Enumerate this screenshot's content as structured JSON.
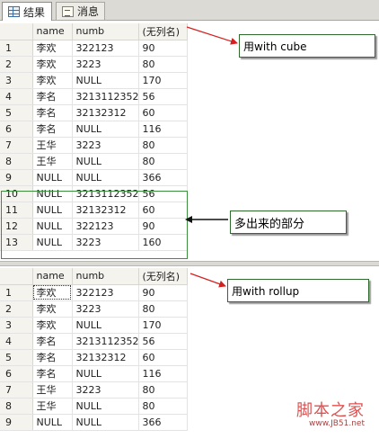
{
  "tabs": [
    {
      "label": "结果",
      "icon": "grid-results-icon",
      "active": true
    },
    {
      "label": "消息",
      "icon": "messages-icon",
      "active": false
    }
  ],
  "columns": [
    "name",
    "numb",
    "(无列名)"
  ],
  "grid_cube": {
    "rows": [
      [
        "1",
        "李欢",
        "322123",
        "90"
      ],
      [
        "2",
        "李欢",
        "3223",
        "80"
      ],
      [
        "3",
        "李欢",
        "NULL",
        "170"
      ],
      [
        "4",
        "李名",
        "3213112352",
        "56"
      ],
      [
        "5",
        "李名",
        "32132312",
        "60"
      ],
      [
        "6",
        "李名",
        "NULL",
        "116"
      ],
      [
        "7",
        "王华",
        "3223",
        "80"
      ],
      [
        "8",
        "王华",
        "NULL",
        "80"
      ],
      [
        "9",
        "NULL",
        "NULL",
        "366"
      ],
      [
        "10",
        "NULL",
        "3213112352",
        "56"
      ],
      [
        "11",
        "NULL",
        "32132312",
        "60"
      ],
      [
        "12",
        "NULL",
        "322123",
        "90"
      ],
      [
        "13",
        "NULL",
        "3223",
        "160"
      ]
    ]
  },
  "grid_rollup": {
    "rows": [
      [
        "1",
        "李欢",
        "322123",
        "90"
      ],
      [
        "2",
        "李欢",
        "3223",
        "80"
      ],
      [
        "3",
        "李欢",
        "NULL",
        "170"
      ],
      [
        "4",
        "李名",
        "3213112352",
        "56"
      ],
      [
        "5",
        "李名",
        "32132312",
        "60"
      ],
      [
        "6",
        "李名",
        "NULL",
        "116"
      ],
      [
        "7",
        "王华",
        "3223",
        "80"
      ],
      [
        "8",
        "王华",
        "NULL",
        "80"
      ],
      [
        "9",
        "NULL",
        "NULL",
        "366"
      ]
    ]
  },
  "annotations": {
    "cube": "用with cube",
    "extra": "多出来的部分",
    "rollup": "用with rollup"
  },
  "watermark": {
    "main": "脚本之家",
    "url": "www.JB51.net"
  },
  "colors": {
    "arrow_red": "#d42020",
    "arrow_black": "#111111",
    "highlight_green": "#3c8f3c"
  }
}
